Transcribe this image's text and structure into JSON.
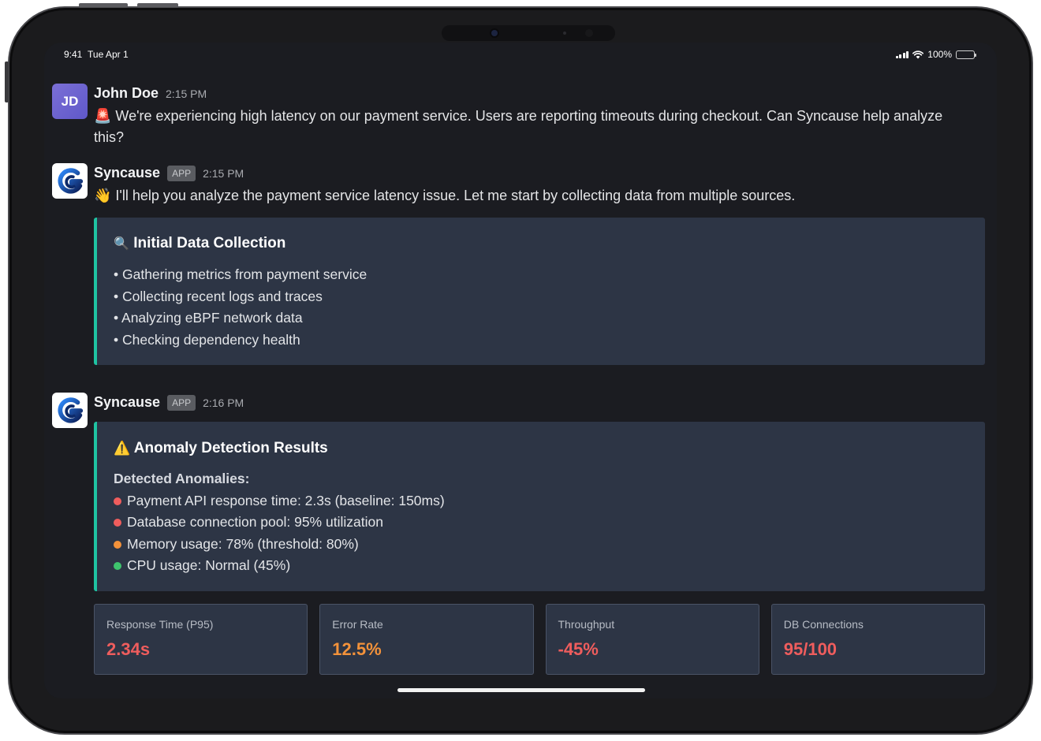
{
  "status_bar": {
    "time": "9:41",
    "date": "Tue Apr 1",
    "battery": "100%"
  },
  "colors": {
    "accent": "#1fc3a2",
    "red": "#ef5d5d",
    "orange": "#f3923a",
    "green": "#3ec46d",
    "card_bg": "#2d3545"
  },
  "messages": [
    {
      "avatar": "JD",
      "sender": "John Doe",
      "time": "2:15 PM",
      "emoji": "🚨",
      "text": " We're experiencing high latency on our payment service. Users are reporting timeouts during checkout. Can Syncause help analyze this?"
    },
    {
      "sender": "Syncause",
      "badge": "APP",
      "time": "2:15 PM",
      "emoji": "👋",
      "text": " I'll help you analyze the payment service latency issue. Let me start by collecting data from multiple sources.",
      "card": {
        "icon": "🔍",
        "title": "Initial Data Collection",
        "items": [
          "• Gathering metrics from payment service",
          "• Collecting recent logs and traces",
          "• Analyzing eBPF network data",
          "• Checking dependency health"
        ]
      }
    },
    {
      "sender": "Syncause",
      "badge": "APP",
      "time": "2:16 PM",
      "card": {
        "icon": "⚠️",
        "title": "Anomaly Detection Results",
        "subheading": "Detected Anomalies:",
        "items": [
          {
            "status": "red",
            "text": "Payment API response time: 2.3s (baseline: 150ms)"
          },
          {
            "status": "red",
            "text": "Database connection pool: 95% utilization"
          },
          {
            "status": "orange",
            "text": "Memory usage: 78% (threshold: 80%)"
          },
          {
            "status": "green",
            "text": "CPU usage: Normal (45%)"
          }
        ]
      },
      "metrics": [
        {
          "label": "Response Time (P95)",
          "value": "2.34s",
          "color": "#ef5d5d"
        },
        {
          "label": "Error Rate",
          "value": "12.5%",
          "color": "#f3923a"
        },
        {
          "label": "Throughput",
          "value": "-45%",
          "color": "#ef5d5d"
        },
        {
          "label": "DB Connections",
          "value": "95/100",
          "color": "#ef5d5d"
        }
      ]
    }
  ]
}
